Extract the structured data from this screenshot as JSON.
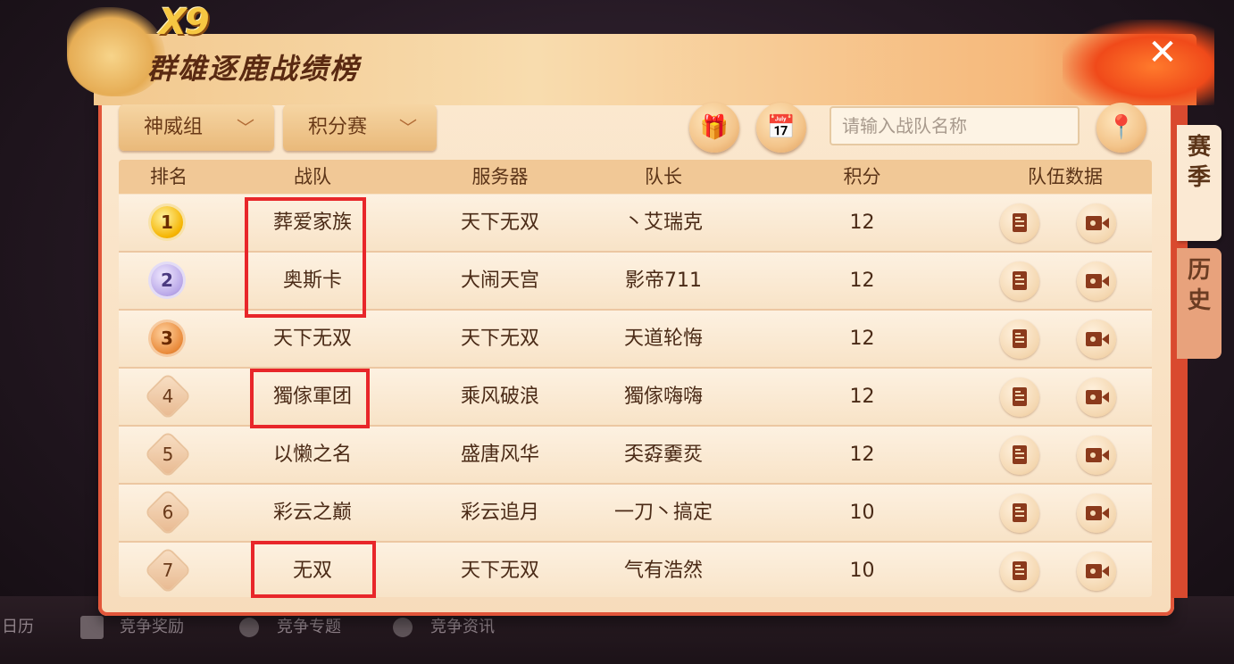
{
  "bottom_bar": {
    "calendar": "日历",
    "reward": "竞争奖励",
    "topic": "竞争专题",
    "news": "竞争资讯"
  },
  "header": {
    "logo_text": "X9",
    "title": "群雄逐鹿战绩榜",
    "close": "✕"
  },
  "side_tabs": {
    "season": "赛季",
    "history": "历史"
  },
  "filters": {
    "group": "神威组",
    "match_type": "积分赛",
    "search_placeholder": "请输入战队名称",
    "chevron": "﹀"
  },
  "icons": {
    "gift": "🎁",
    "calendar": "📅",
    "location": "📍"
  },
  "table": {
    "headers": {
      "rank": "排名",
      "team": "战队",
      "server": "服务器",
      "captain": "队长",
      "score": "积分",
      "data": "队伍数据"
    },
    "rows": [
      {
        "rank": "1",
        "team": "葬爱家族",
        "server": "天下无双",
        "captain": "丶艾瑞克",
        "score": "12"
      },
      {
        "rank": "2",
        "team": "奥斯卡",
        "server": "大闹天宫",
        "captain": "影帝711",
        "score": "12"
      },
      {
        "rank": "3",
        "team": "天下无双",
        "server": "天下无双",
        "captain": "天道轮悔",
        "score": "12"
      },
      {
        "rank": "4",
        "team": "獨傢軍团",
        "server": "乘风破浪",
        "captain": "獨傢嗨嗨",
        "score": "12"
      },
      {
        "rank": "5",
        "team": "以懒之名",
        "server": "盛唐风华",
        "captain": "奀孬嫑烎",
        "score": "12"
      },
      {
        "rank": "6",
        "team": "彩云之巅",
        "server": "彩云追月",
        "captain": "一刀丶搞定",
        "score": "10"
      },
      {
        "rank": "7",
        "team": "无双",
        "server": "天下无双",
        "captain": "气有浩然",
        "score": "10"
      }
    ]
  },
  "colors": {
    "highlight": "#e8262a",
    "accent": "#e2563a",
    "text_dark": "#4a2a16"
  }
}
